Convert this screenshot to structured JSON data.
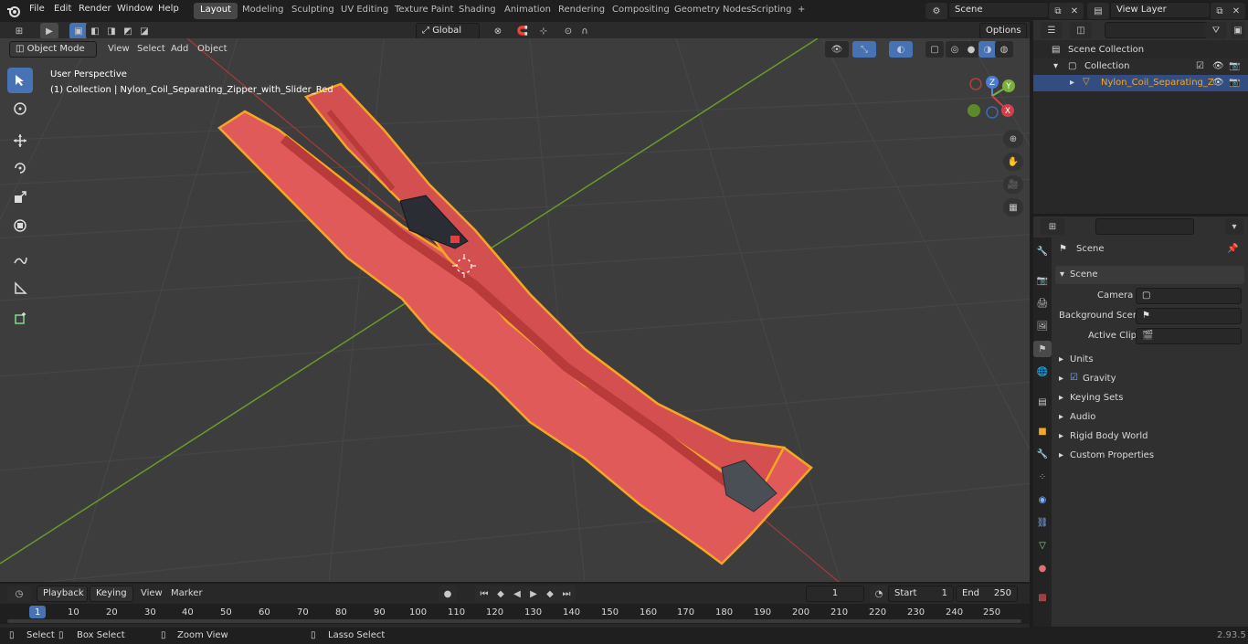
{
  "topbar": {
    "menus": [
      "File",
      "Edit",
      "Render",
      "Window",
      "Help"
    ],
    "workspaces": [
      "Layout",
      "Modeling",
      "Sculpting",
      "UV Editing",
      "Texture Paint",
      "Shading",
      "Animation",
      "Rendering",
      "Compositing",
      "Geometry Nodes",
      "Scripting"
    ],
    "active_workspace": "Layout",
    "scene_name": "Scene",
    "view_layer": "View Layer"
  },
  "viewport_header": {
    "mode": "Object Mode",
    "menus": [
      "View",
      "Select",
      "Add",
      "Object"
    ],
    "transform_orientation": "Global",
    "options_label": "Options"
  },
  "viewport": {
    "perspective_label": "User Perspective",
    "collection_label": "(1) Collection | Nylon_Coil_Separating_Zipper_with_Slider_Red",
    "gizmo": {
      "z": "Z",
      "y": "Y",
      "x": "X"
    },
    "object_color": "#e05a5a",
    "outline_color": "#f5a623"
  },
  "outliner": {
    "search_placeholder": "",
    "items": [
      {
        "label": "Scene Collection",
        "level": 0
      },
      {
        "label": "Collection",
        "level": 1
      },
      {
        "label": "Nylon_Coil_Separating_Z",
        "level": 2,
        "selected": true
      }
    ]
  },
  "properties": {
    "header_title": "Scene",
    "section_title": "Scene",
    "fields": [
      {
        "label": "Camera",
        "value": ""
      },
      {
        "label": "Background Scene",
        "value": ""
      },
      {
        "label": "Active Clip",
        "value": ""
      }
    ],
    "panels": [
      "Units",
      "Gravity",
      "Keying Sets",
      "Audio",
      "Rigid Body World",
      "Custom Properties"
    ]
  },
  "timeline": {
    "menus": [
      "Playback",
      "Keying",
      "View",
      "Marker"
    ],
    "current_frame": "1",
    "start_label": "Start",
    "start_value": "1",
    "end_label": "End",
    "end_value": "250",
    "ruler": [
      "1",
      "10",
      "20",
      "30",
      "40",
      "50",
      "60",
      "70",
      "80",
      "90",
      "100",
      "110",
      "120",
      "130",
      "140",
      "150",
      "160",
      "170",
      "180",
      "190",
      "200",
      "210",
      "220",
      "230",
      "240",
      "250"
    ]
  },
  "statusbar": {
    "select": "Select",
    "box_select": "Box Select",
    "zoom_view": "Zoom View",
    "lasso_select": "Lasso Select",
    "version": "2.93.5"
  }
}
